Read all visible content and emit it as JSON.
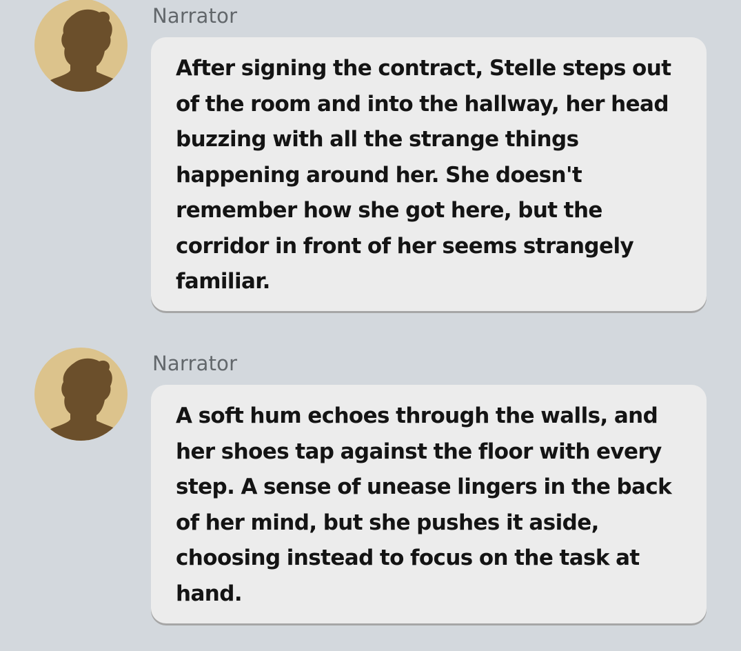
{
  "messages": [
    {
      "sender": "Narrator",
      "avatar_icon": "narrator-silhouette-icon",
      "text": "After signing the contract, Stelle steps out of the room and into the hallway, her head buzzing with all the strange things happening around her. She doesn't remember how she got here, but the corridor in front of her seems strangely familiar."
    },
    {
      "sender": "Narrator",
      "avatar_icon": "narrator-silhouette-icon",
      "text": "A soft hum echoes through the walls, and her shoes tap against the floor with every step. A sense of unease lingers in the back of her mind, but she pushes it aside, choosing instead to focus on the task at hand."
    }
  ],
  "colors": {
    "background": "#d3d8dd",
    "bubble": "#ececec",
    "avatar_bg": "#dcc38c",
    "silhouette": "#6b4f2b",
    "sender_text": "#62676b",
    "message_text": "#141414"
  }
}
